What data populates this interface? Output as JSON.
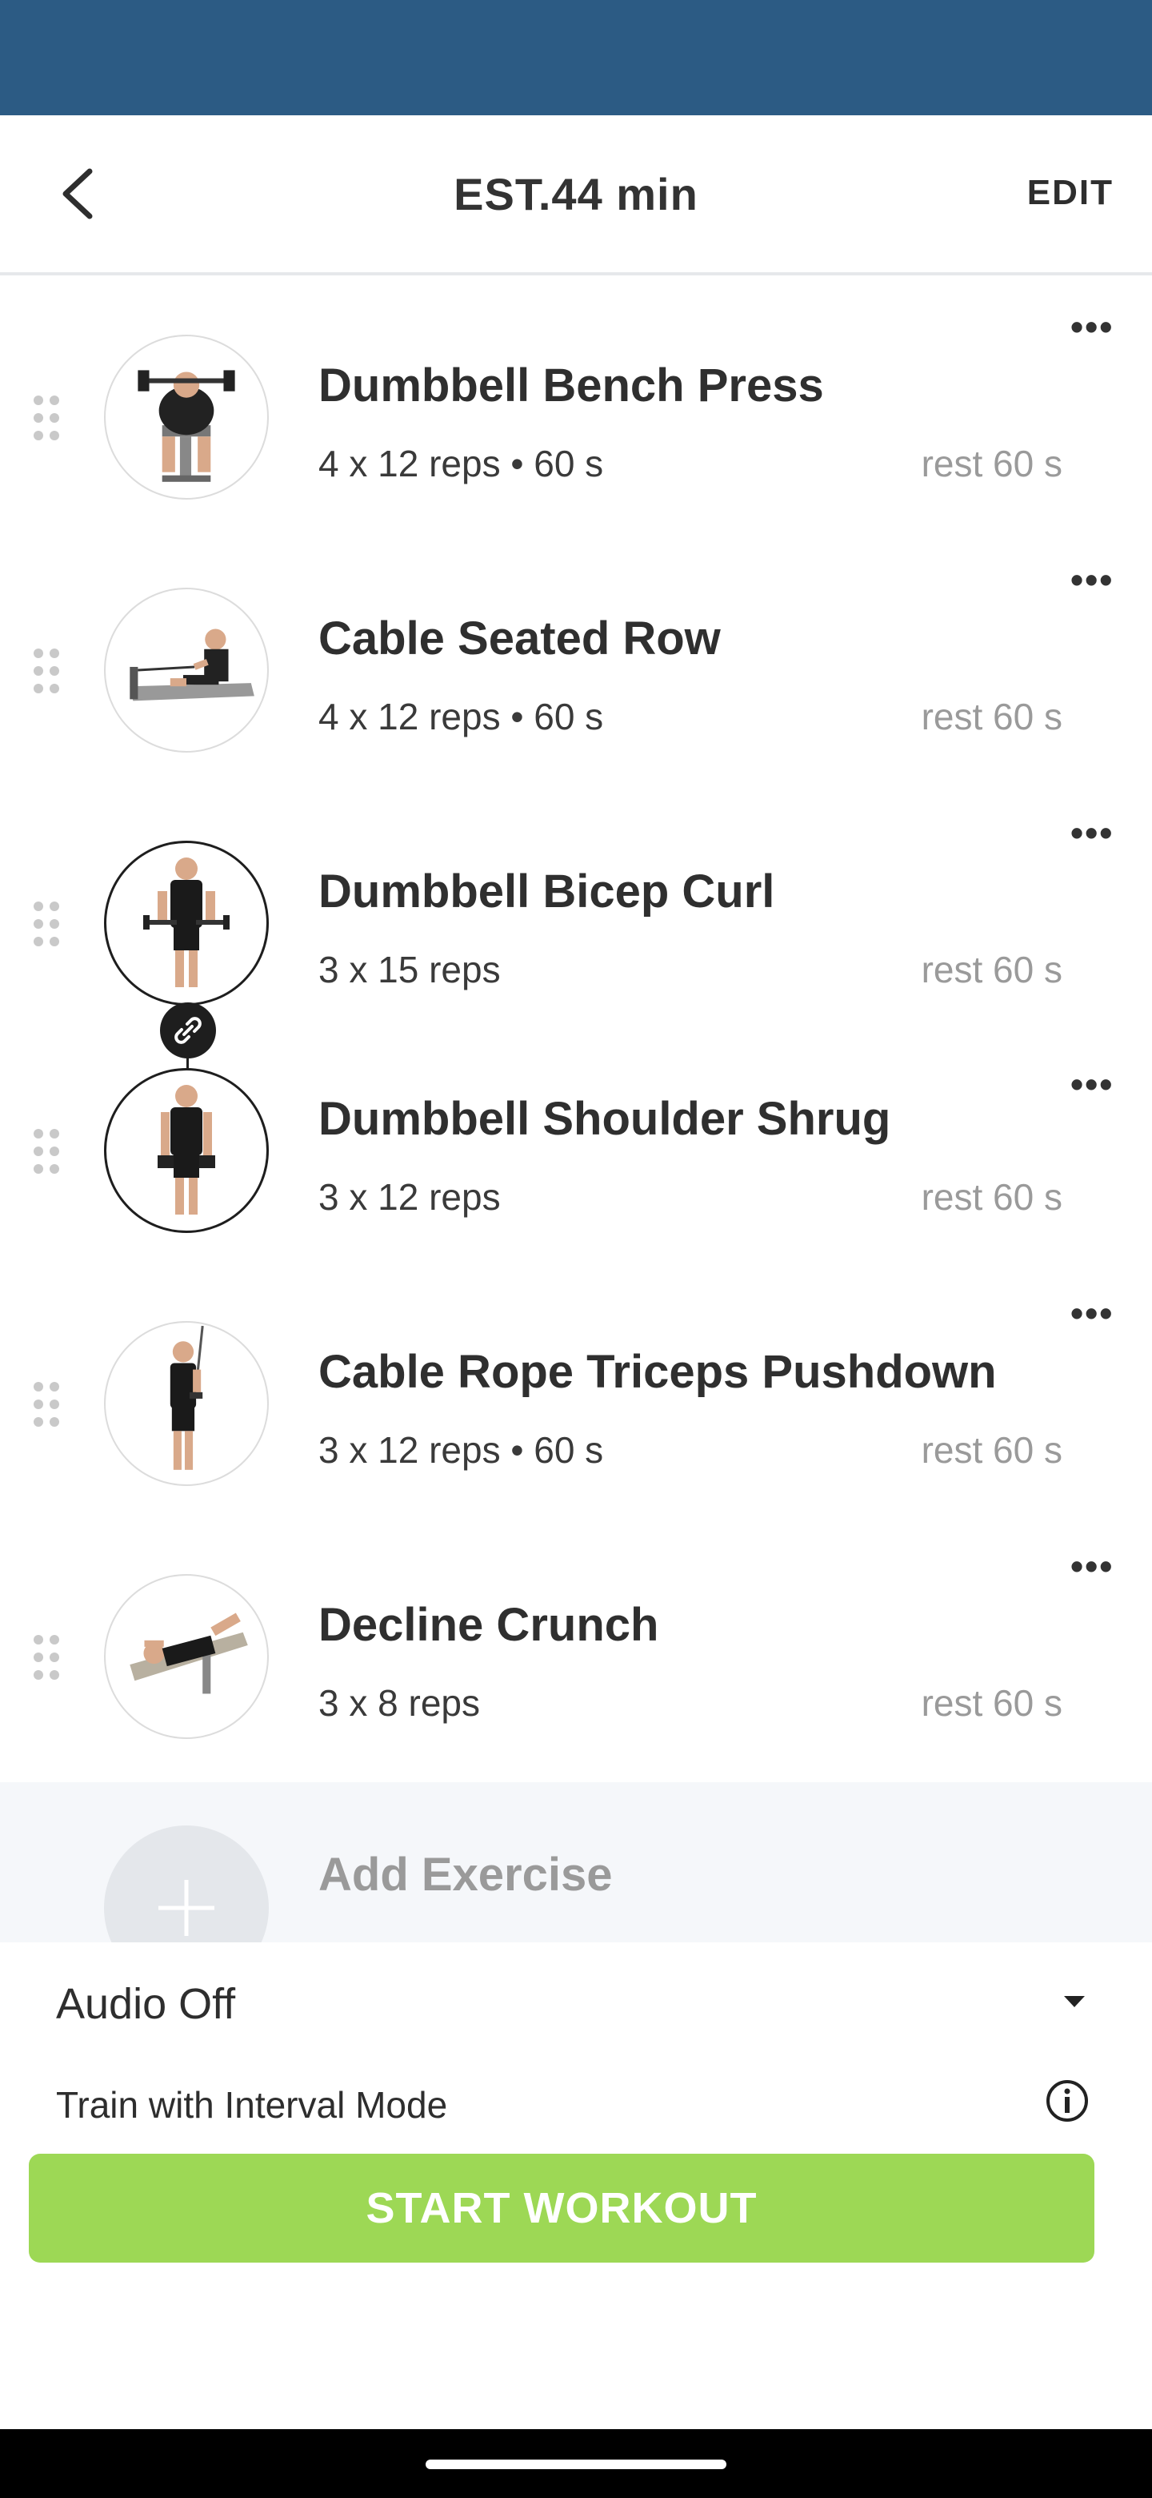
{
  "header": {
    "title": "EST.44 min",
    "edit_label": "EDIT"
  },
  "exercises": [
    {
      "name": "Dumbbell Bench Press",
      "detail": "4 x 12 reps • 60 s",
      "rest": "rest 60 s"
    },
    {
      "name": "Cable Seated Row",
      "detail": "4 x 12 reps • 60 s",
      "rest": "rest 60 s"
    },
    {
      "name": "Dumbbell Bicep Curl",
      "detail": "3 x 15 reps",
      "rest": "rest 60 s"
    },
    {
      "name": "Dumbbell Shoulder Shrug",
      "detail": "3 x 12 reps",
      "rest": "rest 60 s"
    },
    {
      "name": "Cable Rope Triceps Pushdown",
      "detail": "3 x 12 reps • 60 s",
      "rest": "rest 60 s"
    },
    {
      "name": "Decline Crunch",
      "detail": "3 x 8 reps",
      "rest": "rest 60 s"
    }
  ],
  "more_label": "•••",
  "add_exercise": {
    "label": "Add Exercise"
  },
  "settings": {
    "audio": "Audio Off",
    "interval_mode": "Train with Interval Mode"
  },
  "start_button": "START WORKOUT",
  "colors": {
    "status_bar": "#2c5b84",
    "start_button": "#9dd855"
  }
}
